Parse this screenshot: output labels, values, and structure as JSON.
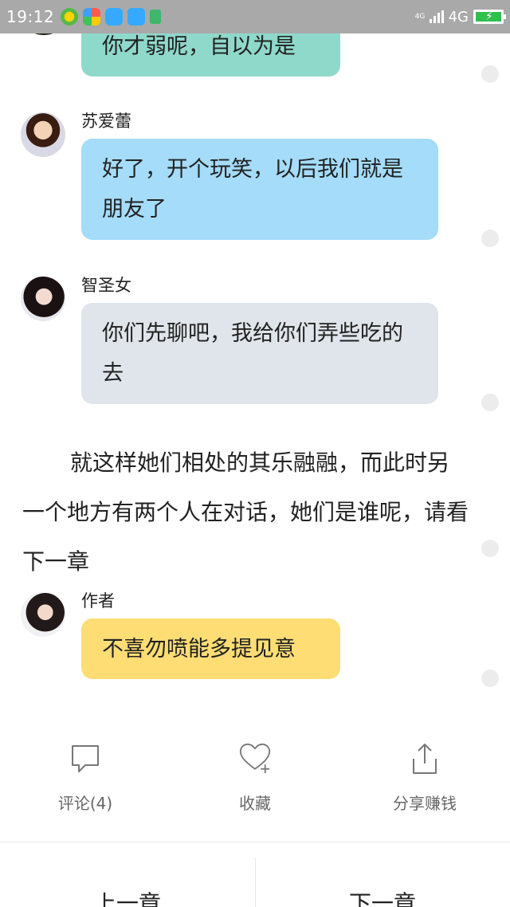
{
  "status_bar": {
    "time": "19:12",
    "signal_small_label": "4G",
    "network_label": "4G"
  },
  "messages": [
    {
      "speaker": "",
      "text": "你才弱呢，自以为是",
      "color": "#8fd9cb"
    },
    {
      "speaker": "苏爱蕾",
      "text": "好了，开个玩笑，以后我们就是朋友了",
      "color": "#a4dcf9"
    },
    {
      "speaker": "智圣女",
      "text": "你们先聊吧，我给你们弄些吃的去",
      "color": "#dfe5ea"
    }
  ],
  "narration": "就这样她们相处的其乐融融，而此时另一个地方有两个人在对话，她们是谁呢，请看下一章",
  "author_note": {
    "speaker": "作者",
    "text": "不喜勿喷能多提见意",
    "color": "#fedd75"
  },
  "actions": {
    "comment": {
      "label": "评论(4)",
      "icon": "comment-icon"
    },
    "favorite": {
      "label": "收藏",
      "icon": "heart-plus-icon"
    },
    "share": {
      "label": "分享赚钱",
      "icon": "share-icon"
    }
  },
  "navigation": {
    "prev_label": "上一章",
    "next_label": "下一章"
  }
}
